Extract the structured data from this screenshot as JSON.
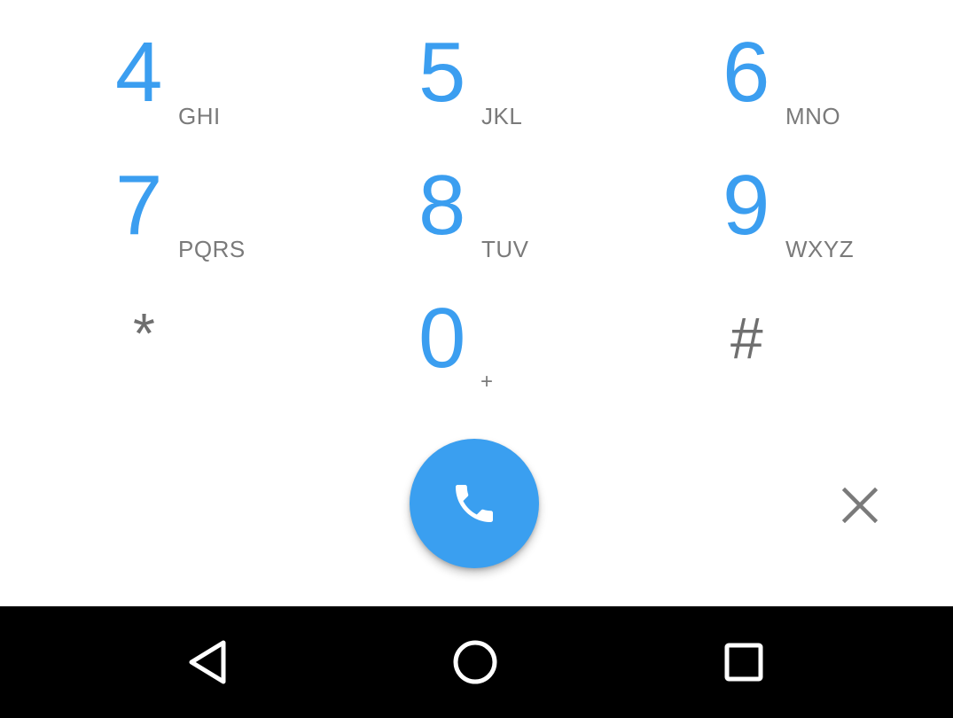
{
  "dialpad": {
    "keys": [
      {
        "digit": "4",
        "letters": "GHI"
      },
      {
        "digit": "5",
        "letters": "JKL"
      },
      {
        "digit": "6",
        "letters": "MNO"
      },
      {
        "digit": "7",
        "letters": "PQRS"
      },
      {
        "digit": "8",
        "letters": "TUV"
      },
      {
        "digit": "9",
        "letters": "WXYZ"
      },
      {
        "digit": "*",
        "letters": ""
      },
      {
        "digit": "0",
        "letters": "+"
      },
      {
        "digit": "#",
        "letters": ""
      }
    ]
  },
  "actions": {
    "call_icon": "phone-icon",
    "delete_icon": "close-icon"
  },
  "navbar": {
    "back_icon": "back-triangle-icon",
    "home_icon": "home-circle-icon",
    "recents_icon": "recents-square-icon"
  },
  "colors": {
    "digit": "#3b9ef0",
    "letters": "#7a7a7a",
    "call_button": "#3a9ff0",
    "navbar": "#000000"
  }
}
